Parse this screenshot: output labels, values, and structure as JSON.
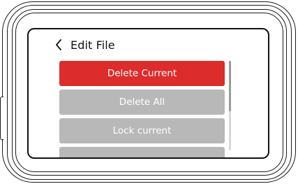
{
  "header": {
    "back_icon": "chevron-left-icon",
    "title": "Edit File"
  },
  "menu": {
    "items": [
      {
        "label": "Delete Current",
        "state": "selected",
        "color": "#dd2c2c"
      },
      {
        "label": "Delete All",
        "state": "normal",
        "color": "#b8b8b8"
      },
      {
        "label": "Lock current",
        "state": "normal",
        "color": "#b8b8b8"
      },
      {
        "label": "",
        "state": "partially-visible",
        "color": "#b8b8b8"
      }
    ]
  },
  "scrollbar": {
    "position_fraction": 0.0,
    "visible_fraction": 0.56
  }
}
